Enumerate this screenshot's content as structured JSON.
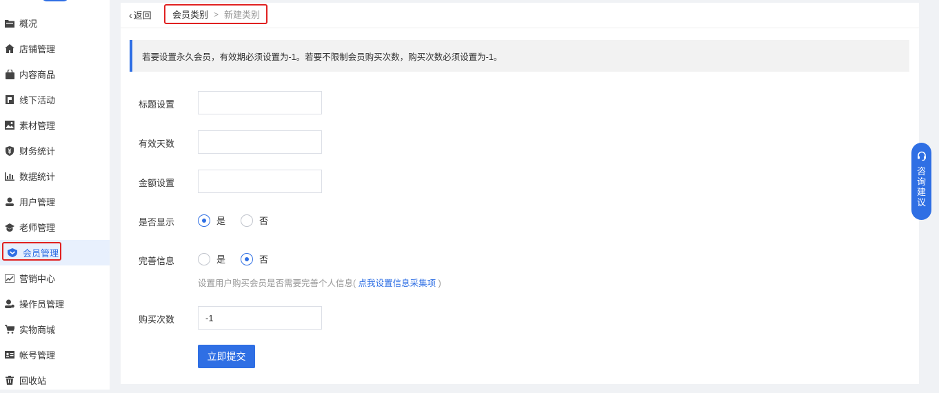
{
  "sidebar": {
    "items": [
      {
        "label": "概况",
        "icon": "folder-icon"
      },
      {
        "label": "店铺管理",
        "icon": "home-icon"
      },
      {
        "label": "内容商品",
        "icon": "bag-icon"
      },
      {
        "label": "线下活动",
        "icon": "flag-icon"
      },
      {
        "label": "素材管理",
        "icon": "image-icon"
      },
      {
        "label": "财务统计",
        "icon": "yen-shield-icon"
      },
      {
        "label": "数据统计",
        "icon": "bar-chart-icon"
      },
      {
        "label": "用户管理",
        "icon": "user-icon"
      },
      {
        "label": "老师管理",
        "icon": "graduation-cap-icon"
      },
      {
        "label": "会员管理",
        "icon": "member-badge-icon",
        "active": true
      },
      {
        "label": "营销中心",
        "icon": "trend-icon"
      },
      {
        "label": "操作员管理",
        "icon": "operator-icon"
      },
      {
        "label": "实物商城",
        "icon": "cart-icon"
      },
      {
        "label": "帐号管理",
        "icon": "id-card-icon"
      },
      {
        "label": "回收站",
        "icon": "trash-icon"
      }
    ]
  },
  "topbar": {
    "back_label": "返回",
    "breadcrumb": {
      "parent": "会员类别",
      "separator": ">",
      "current": "新建类别"
    }
  },
  "notice": "若要设置永久会员，有效期必须设置为-1。若要不限制会员购买次数，购买次数必须设置为-1。",
  "form": {
    "title_label": "标题设置",
    "title_value": "",
    "days_label": "有效天数",
    "days_value": "",
    "amount_label": "金额设置",
    "amount_value": "",
    "display_label": "是否显示",
    "display_yes": "是",
    "display_no": "否",
    "display_selected": "是",
    "info_label": "完善信息",
    "info_yes": "是",
    "info_no": "否",
    "info_selected": "否",
    "info_hint_prefix": "设置用户购买会员是否需要完善个人信息(",
    "info_hint_link": "点我设置信息采集项",
    "info_hint_suffix": ")",
    "purchase_label": "购买次数",
    "purchase_value": "-1",
    "submit_label": "立即提交"
  },
  "consult": {
    "label": "咨询建议",
    "icon": "headset-icon"
  },
  "colors": {
    "accent": "#2f6fe4",
    "highlight": "#e02020"
  }
}
